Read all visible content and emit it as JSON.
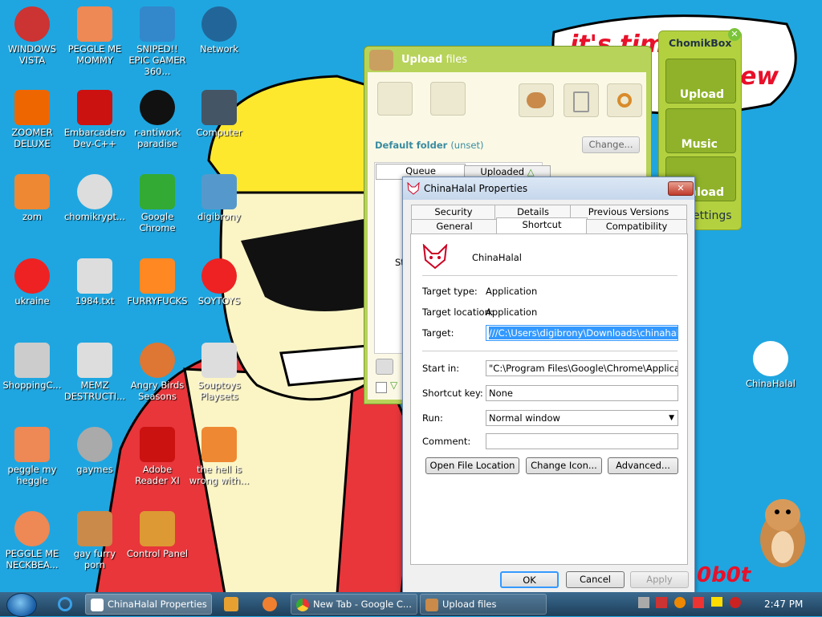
{
  "desktop_icons": [
    {
      "label": "WINDOWS VISTA"
    },
    {
      "label": "PEGGLE ME MOMMY"
    },
    {
      "label": "SNIPED!! EPIC GAMER 360..."
    },
    {
      "label": "Network"
    },
    {
      "label": "ZOOMER DELUXE"
    },
    {
      "label": "Embarcadero Dev-C++"
    },
    {
      "label": "r-antiwork paradise"
    },
    {
      "label": "Computer"
    },
    {
      "label": "zom"
    },
    {
      "label": "chomikrypt..."
    },
    {
      "label": "Google Chrome"
    },
    {
      "label": "digibrony"
    },
    {
      "label": "ukraine"
    },
    {
      "label": "1984.txt"
    },
    {
      "label": "FURRYFUCKS"
    },
    {
      "label": "SOYTOYS"
    },
    {
      "label": "ShoppingC..."
    },
    {
      "label": "MEMZ DESTRUCTI..."
    },
    {
      "label": "Angry Birds Seasons"
    },
    {
      "label": "Souptoys Playsets"
    },
    {
      "label": "peggle my heggle"
    },
    {
      "label": "gaymes"
    },
    {
      "label": "Adobe Reader XI"
    },
    {
      "label": "the hell is wrong with..."
    },
    {
      "label": "PEGGLE ME NECKBEA..."
    },
    {
      "label": "gay furry porn"
    },
    {
      "label": "Control Panel"
    },
    {
      "label": "ChinaHalal"
    }
  ],
  "wallpaper": {
    "speech": "it's time shit",
    "speech2": "ew",
    "corner_text": "0b0t"
  },
  "upload_window": {
    "title_bold": "Upload",
    "title_rest": " files",
    "default_folder_label": "Default folder",
    "default_folder_value": "(unset)",
    "change_button": "Change...",
    "tabs": [
      "Queue",
      "Uploaded"
    ],
    "partial_text": "St"
  },
  "chomikbox": {
    "title": "ChomikBox",
    "buttons": [
      "Upload",
      "Music",
      "nload"
    ],
    "settings": "ettings"
  },
  "properties": {
    "title": "ChinaHalal Properties",
    "tabs_row1": [
      "Security",
      "Details",
      "Previous Versions"
    ],
    "tabs_row2": [
      "General",
      "Shortcut",
      "Compatibility"
    ],
    "name": "ChinaHalal",
    "target_type_label": "Target type:",
    "target_type_value": "Application",
    "target_location_label": "Target location:",
    "target_location_value": "Application",
    "target_label": "Target:",
    "target_value": "///C:\\Users\\digibrony\\Downloads\\chinahalal.htm",
    "start_in_label": "Start in:",
    "start_in_value": "\"C:\\Program Files\\Google\\Chrome\\Application\"",
    "shortcut_key_label": "Shortcut key:",
    "shortcut_key_value": "None",
    "run_label": "Run:",
    "run_value": "Normal window",
    "comment_label": "Comment:",
    "comment_value": "",
    "open_file_location": "Open File Location",
    "change_icon": "Change Icon...",
    "advanced": "Advanced...",
    "ok": "OK",
    "cancel": "Cancel",
    "apply": "Apply"
  },
  "taskbar": {
    "items": [
      "ChinaHalal Properties",
      "New Tab - Google C...",
      "Upload files"
    ],
    "clock": "2:47 PM"
  },
  "colors": {
    "desktop": "#1fa6e0",
    "upload_green": "#b8d35a",
    "accent_blue": "#3399ff"
  }
}
